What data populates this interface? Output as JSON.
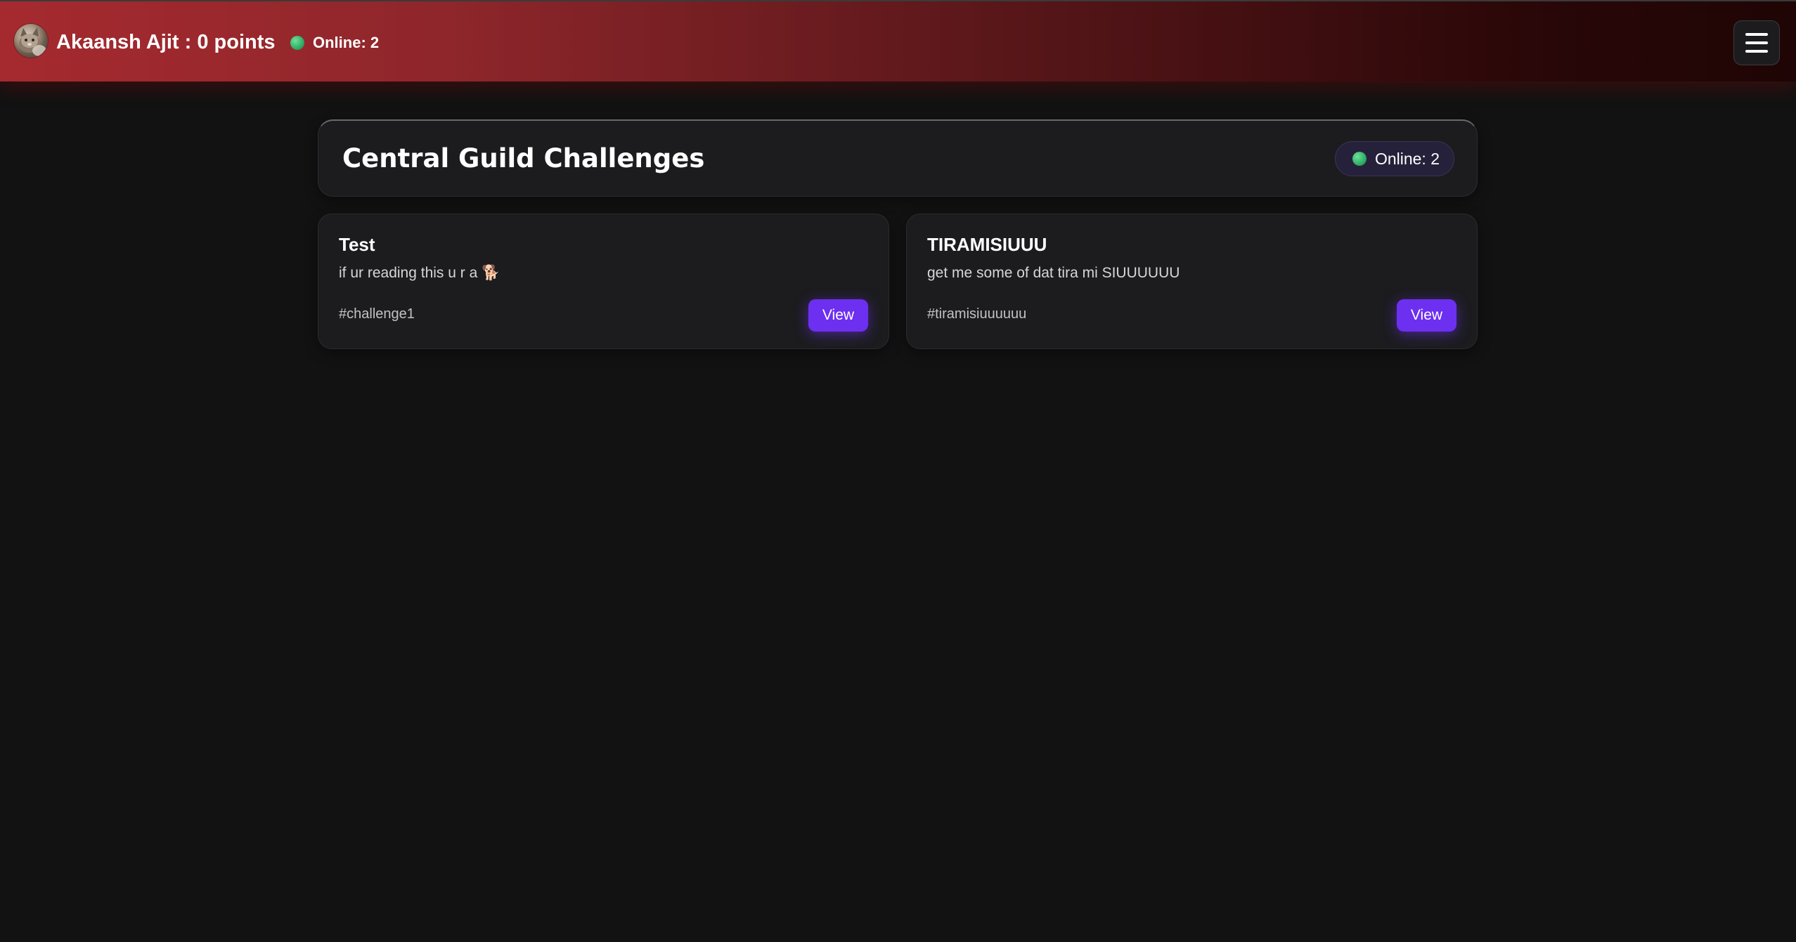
{
  "header": {
    "user_title": "Akaansh Ajit : 0 points",
    "online_text": "Online: 2",
    "menu_icon": "hamburger-menu-icon",
    "avatar_icon": "cat-avatar"
  },
  "main": {
    "title": "Central Guild Challenges",
    "online_text": "Online: 2",
    "challenges": [
      {
        "title": "Test",
        "description": "if ur reading this u r a 🐕",
        "tag": "#challenge1",
        "button_label": "View"
      },
      {
        "title": "TIRAMISIUUU",
        "description": "get me some of dat tira mi SIUUUUUU",
        "tag": "#tiramisiuuuuuu",
        "button_label": "View"
      }
    ]
  },
  "colors": {
    "background": "#121212",
    "topbar_start": "#a52a2f",
    "topbar_end": "#1f0505",
    "card": "#1c1c1f",
    "accent_button": "#6d2ff0",
    "online_dot": "#34b36a",
    "online_pill": "#26213a"
  }
}
